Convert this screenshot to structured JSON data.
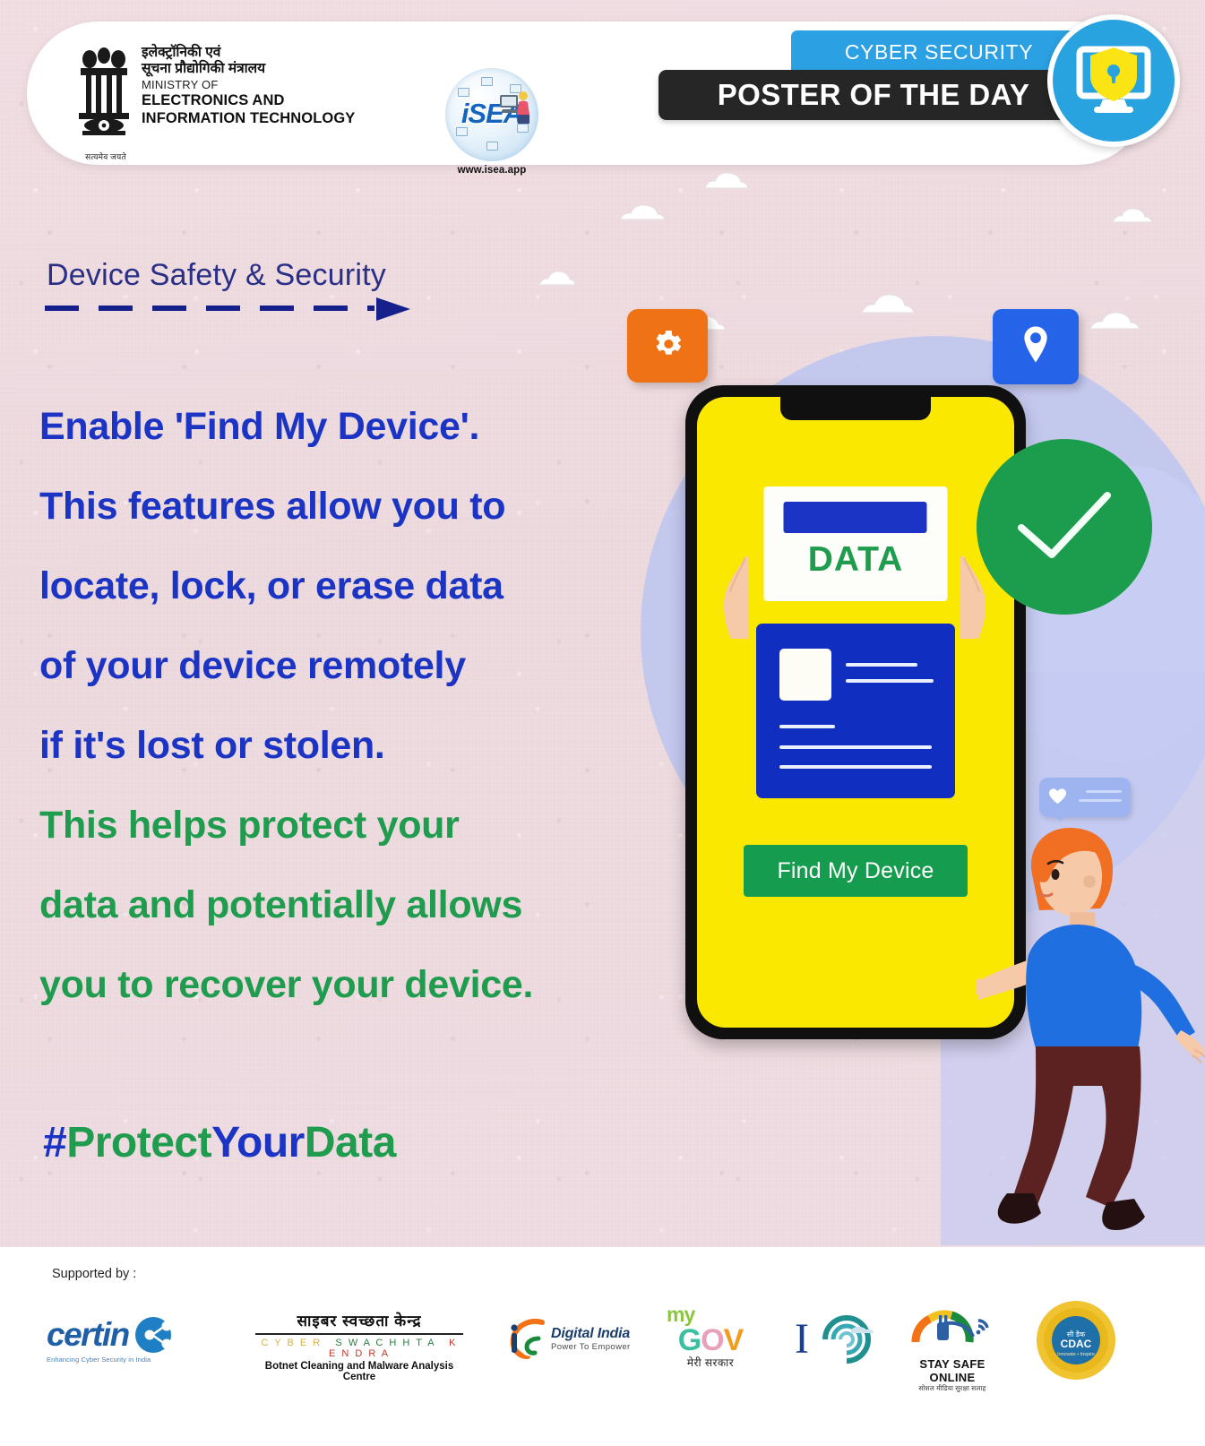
{
  "header": {
    "ministry": {
      "hindi_line1": "इलेक्ट्रॉनिकी एवं",
      "hindi_line2": "सूचना प्रौद्योगिकी मंत्रालय",
      "english_line1": "MINISTRY OF",
      "english_line2": "ELECTRONICS AND",
      "english_line3": "INFORMATION TECHNOLOGY",
      "emblem_motto": "सत्यमेव जयते"
    },
    "isea": {
      "wordmark": "iSEA",
      "url": "www.isea.app"
    },
    "badge": {
      "top_label": "CYBER SECURITY",
      "main_label": "POSTER OF THE DAY"
    }
  },
  "section": {
    "label": "Device Safety & Security"
  },
  "copy": {
    "blue_lines": [
      "Enable 'Find My Device'.",
      "This features allow you to",
      "locate, lock, or erase data",
      "of your device remotely",
      "if it's lost or stolen."
    ],
    "green_lines": [
      "This helps protect your",
      "data and potentially allows",
      "you to recover your device."
    ],
    "hashtag": {
      "hash": "#",
      "part1": "Protect",
      "part2": "Your",
      "part3": "Data"
    }
  },
  "illustration": {
    "phone_card_text": "DATA",
    "find_my_device_button": "Find My Device",
    "gear_tile_icon": "gear-icon",
    "pin_tile_icon": "location-pin-icon",
    "check_icon": "checkmark-icon",
    "bubble_icon": "heart-icon"
  },
  "footer": {
    "supported_by": "Supported by :",
    "logos": [
      {
        "name": "cert-in",
        "word": "certin",
        "tagline": "Enhancing Cyber Security in India"
      },
      {
        "name": "cyber-swachhta-kendra",
        "hindi": "साइबर स्वच्छता केन्द्र",
        "english": "CYBER  SWACHHTA  KENDRA",
        "sub": "Botnet Cleaning and Malware Analysis Centre"
      },
      {
        "name": "digital-india",
        "title": "Digital India",
        "tagline": "Power To Empower"
      },
      {
        "name": "mygov",
        "my": "my",
        "gov": "GOV",
        "hindi": "मेरी सरकार"
      },
      {
        "name": "icert-wave",
        "letter": "I"
      },
      {
        "name": "stay-safe-online",
        "title": "STAY SAFE ONLINE",
        "hindi": "सोशल मीडिया सुरक्षा सलाह"
      },
      {
        "name": "cdac-seal",
        "title": "CDAC",
        "sub": "सी डैक"
      }
    ]
  },
  "colors": {
    "blue_text": "#1b34c4",
    "green_text": "#1f9c4d",
    "navy_label": "#2a2f86",
    "badge_blue": "#2ba0e3",
    "badge_black": "#262626",
    "phone_yellow": "#fae800",
    "orange_tile": "#ef7215",
    "blue_tile": "#2563e8",
    "lavender": "#bcc4f0",
    "background_pink": "#ecd9de"
  }
}
